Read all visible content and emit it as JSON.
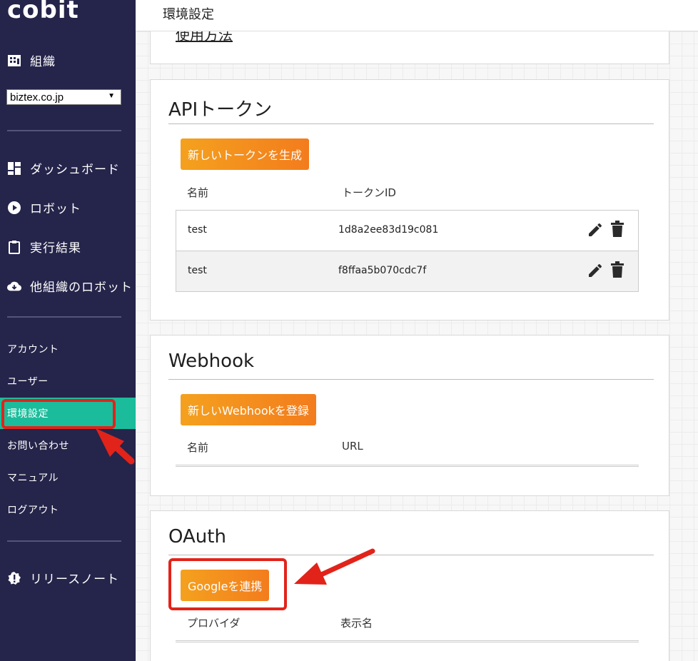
{
  "sidebar": {
    "logo": "cobit",
    "org_label": "組織",
    "org_select_value": "biztex.co.jp",
    "nav": [
      {
        "label": "ダッシュボード",
        "icon": "dashboard-icon"
      },
      {
        "label": "ロボット",
        "icon": "play-circle-icon"
      },
      {
        "label": "実行結果",
        "icon": "clipboard-icon"
      },
      {
        "label": "他組織のロボット",
        "icon": "cloud-download-icon"
      }
    ],
    "menu": [
      {
        "label": "アカウント"
      },
      {
        "label": "ユーザー"
      },
      {
        "label": "環境設定",
        "active": true
      },
      {
        "label": "お問い合わせ"
      },
      {
        "label": "マニュアル"
      },
      {
        "label": "ログアウト"
      }
    ],
    "release_notes": "リリースノート"
  },
  "header": {
    "title": "環境設定"
  },
  "top_card": {
    "partial_link": "使用方法"
  },
  "api_token": {
    "title": "APIトークン",
    "button": "新しいトークンを生成",
    "col_name": "名前",
    "col_token": "トークンID",
    "rows": [
      {
        "name": "test",
        "token": "1d8a2ee83d19c081"
      },
      {
        "name": "test",
        "token": "f8ffaa5b070cdc7f"
      }
    ]
  },
  "webhook": {
    "title": "Webhook",
    "button": "新しいWebhookを登録",
    "col_name": "名前",
    "col_url": "URL"
  },
  "oauth": {
    "title": "OAuth",
    "button": "Googleを連携",
    "col_provider": "プロバイダ",
    "col_display": "表示名"
  },
  "colors": {
    "sidebar_bg": "#25244a",
    "active_menu": "#1bbc9b",
    "button_orange": "#f37c1d",
    "annotation_red": "#e2231a"
  }
}
